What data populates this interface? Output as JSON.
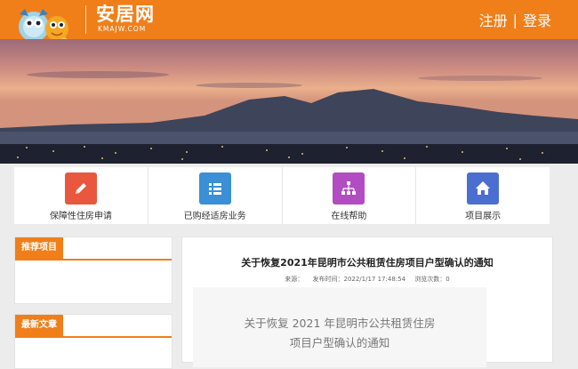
{
  "header": {
    "brand_text": "安居网",
    "brand_sub": "KMAJW.COM",
    "register_label": "注册",
    "separator": "|",
    "login_label": "登录",
    "accent_color": "#f07f1a"
  },
  "services": [
    {
      "label": "保障性住房申请",
      "icon": "pencil-icon",
      "color": "#e9573f"
    },
    {
      "label": "已购经适房业务",
      "icon": "list-icon",
      "color": "#3a8fd6"
    },
    {
      "label": "在线帮助",
      "icon": "sitemap-icon",
      "color": "#b24cc3"
    },
    {
      "label": "项目展示",
      "icon": "home-icon",
      "color": "#4a6fd1"
    }
  ],
  "sidebar": {
    "recommended_title": "推荐项目",
    "latest_title": "最新文章"
  },
  "article": {
    "title": "关于恢复2021年昆明市公共租赁住房项目户型确认的通知",
    "source_label": "来源：",
    "publish_label": "发布时间：2022/1/17 17:48:54",
    "views_label": "浏览次数：0",
    "box_line1": "关于恢复 2021 年昆明市公共租赁住房",
    "box_line2": "项目户型确认的通知"
  }
}
